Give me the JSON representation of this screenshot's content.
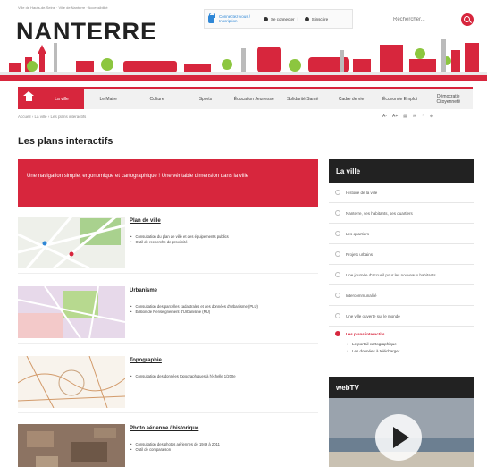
{
  "header": {
    "tagline": "Ville de Hauts-de-Seine · Ville de Nanterre · Accessibilité",
    "logo": "NANTERRE",
    "connect_label": "Connectez-vous / Inscription",
    "login_label": "Se connecter",
    "register_label": "S'inscrire",
    "search_placeholder": "Rechercher..."
  },
  "nav": {
    "items": [
      {
        "label": "La ville"
      },
      {
        "label": "Le Maire"
      },
      {
        "label": "Culture"
      },
      {
        "label": "Sports"
      },
      {
        "label": "Éducation Jeunesse"
      },
      {
        "label": "Solidarité Santé"
      },
      {
        "label": "Cadre de vie"
      },
      {
        "label": "Économie Emploi"
      },
      {
        "label": "Démocratie Citoyenneté"
      }
    ]
  },
  "breadcrumb": "Accueil › La ville › Les plans interactifs",
  "tools": [
    "A-",
    "A+",
    "▤",
    "✉",
    "❝",
    "⊕"
  ],
  "page_title": "Les plans interactifs",
  "banner_text": "Une navigation simple, ergonomique et cartographique ! Une véritable dimension dans la ville",
  "entries": [
    {
      "title": "Plan de ville",
      "bullets": [
        "Consultation du plan de ville et des équipements publics",
        "Outil de recherche de proximité"
      ]
    },
    {
      "title": "Urbanisme",
      "bullets": [
        "Consultation des parcelles cadastrales et des données d'urbanisme (PLU)",
        "Édition de Renseignement d'Urbanisme (RU)"
      ]
    },
    {
      "title": "Topographie",
      "bullets": [
        "Consultation des données topographiques à l'échelle 1/200e"
      ]
    },
    {
      "title": "Photo aérienne / historique",
      "bullets": [
        "Consultation des photos aériennes de 1949 à 2011",
        "Outil de comparaison"
      ]
    }
  ],
  "sidebar": {
    "heading": "La ville",
    "items": [
      {
        "label": "Histoire de la ville"
      },
      {
        "label": "Nanterre, ses habitants, ses quartiers"
      },
      {
        "label": "Les quartiers"
      },
      {
        "label": "Projets urbains"
      },
      {
        "label": "Une journée d'accueil pour les nouveaux habitants"
      },
      {
        "label": "Intercommunalité"
      },
      {
        "label": "Une ville ouverte sur le monde"
      }
    ],
    "active_item": "Les plans interactifs",
    "sub_items": [
      "Le portail cartographique",
      "Les données à télécharger"
    ]
  },
  "webtv": {
    "heading": "webTV"
  },
  "colors": {
    "accent": "#d7263d",
    "dark": "#222222",
    "link": "#2f87d6"
  }
}
